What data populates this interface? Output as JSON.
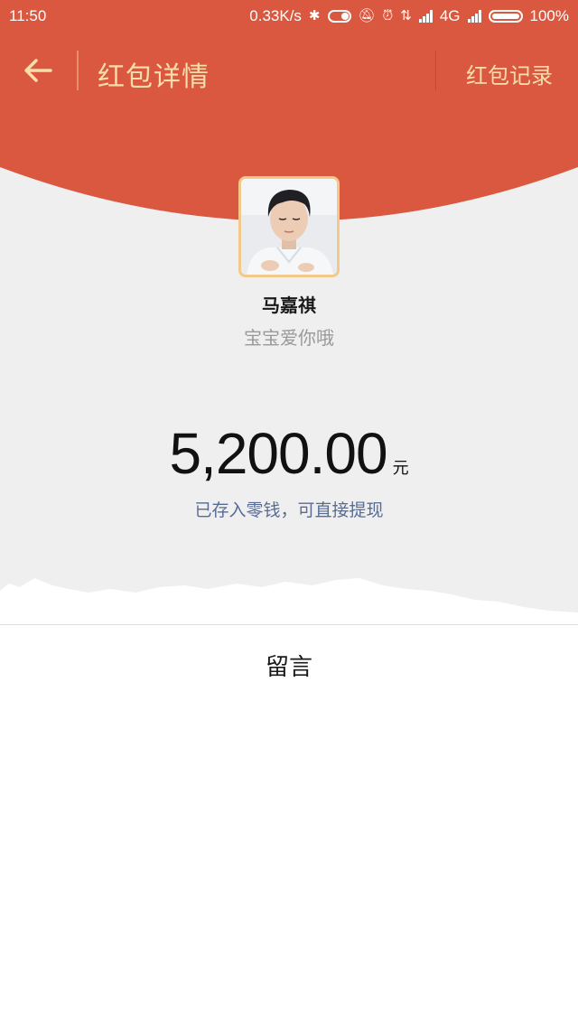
{
  "status_bar": {
    "time": "11:50",
    "net_speed": "0.33K/s",
    "network": "4G",
    "battery": "100%",
    "icons": [
      "bluetooth-icon",
      "toggle-icon",
      "mute-icon",
      "alarm-icon",
      "data-arrows-icon",
      "signal-icon",
      "signal-icon",
      "battery-icon"
    ]
  },
  "nav": {
    "back_icon": "arrow-left-icon",
    "title": "红包详情",
    "record_label": "红包记录"
  },
  "sender": {
    "name": "马嘉祺",
    "wish": "宝宝爱你哦"
  },
  "amount": {
    "value": "5,200.00",
    "unit": "元"
  },
  "deposit_note": "已存入零钱，可直接提现",
  "message_label": "留言",
  "colors": {
    "header_red": "#d9583f",
    "title_gold": "#f9ddaa",
    "link_blue": "#576b95",
    "background_gray": "#efefef"
  }
}
